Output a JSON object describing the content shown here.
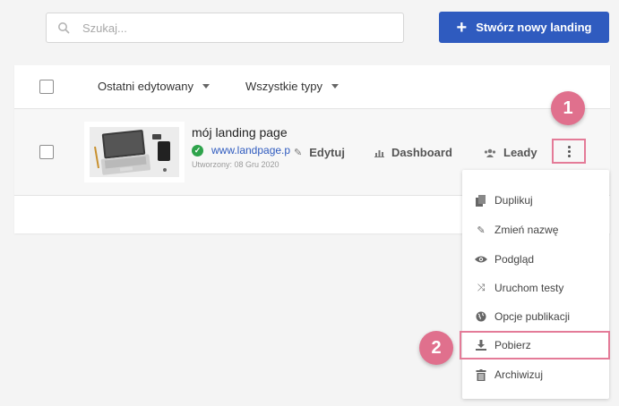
{
  "search": {
    "placeholder": "Szukaj..."
  },
  "toolbar": {
    "create_label": "Stwórz nowy landing",
    "create_icon": "plus-icon"
  },
  "filters": {
    "sort_label": "Ostatni edytowany",
    "type_label": "Wszystkie typy"
  },
  "landing": {
    "title": "mój landing page",
    "url": "www.landpage.p",
    "created": "Utworzony: 08 Gru 2020",
    "status": "published"
  },
  "actions": {
    "edit_label": "Edytuj",
    "dashboard_label": "Dashboard",
    "leads_label": "Leady"
  },
  "annotations": {
    "step1": "1",
    "step2": "2",
    "highlight_color": "#e47b98"
  },
  "menu": {
    "items": [
      {
        "label": "Duplikuj",
        "icon": "copy-icon"
      },
      {
        "label": "Zmień nazwę",
        "icon": "edit-icon"
      },
      {
        "label": "Podgląd",
        "icon": "eye-icon"
      },
      {
        "label": "Uruchom testy",
        "icon": "shuffle-icon"
      },
      {
        "label": "Opcje publikacji",
        "icon": "globe-icon"
      },
      {
        "label": "Pobierz",
        "icon": "download-icon"
      },
      {
        "label": "Archiwizuj",
        "icon": "trash-icon"
      }
    ]
  },
  "colors": {
    "primary": "#2f5bbf",
    "success": "#2ea34b",
    "badge": "#e0708d"
  }
}
